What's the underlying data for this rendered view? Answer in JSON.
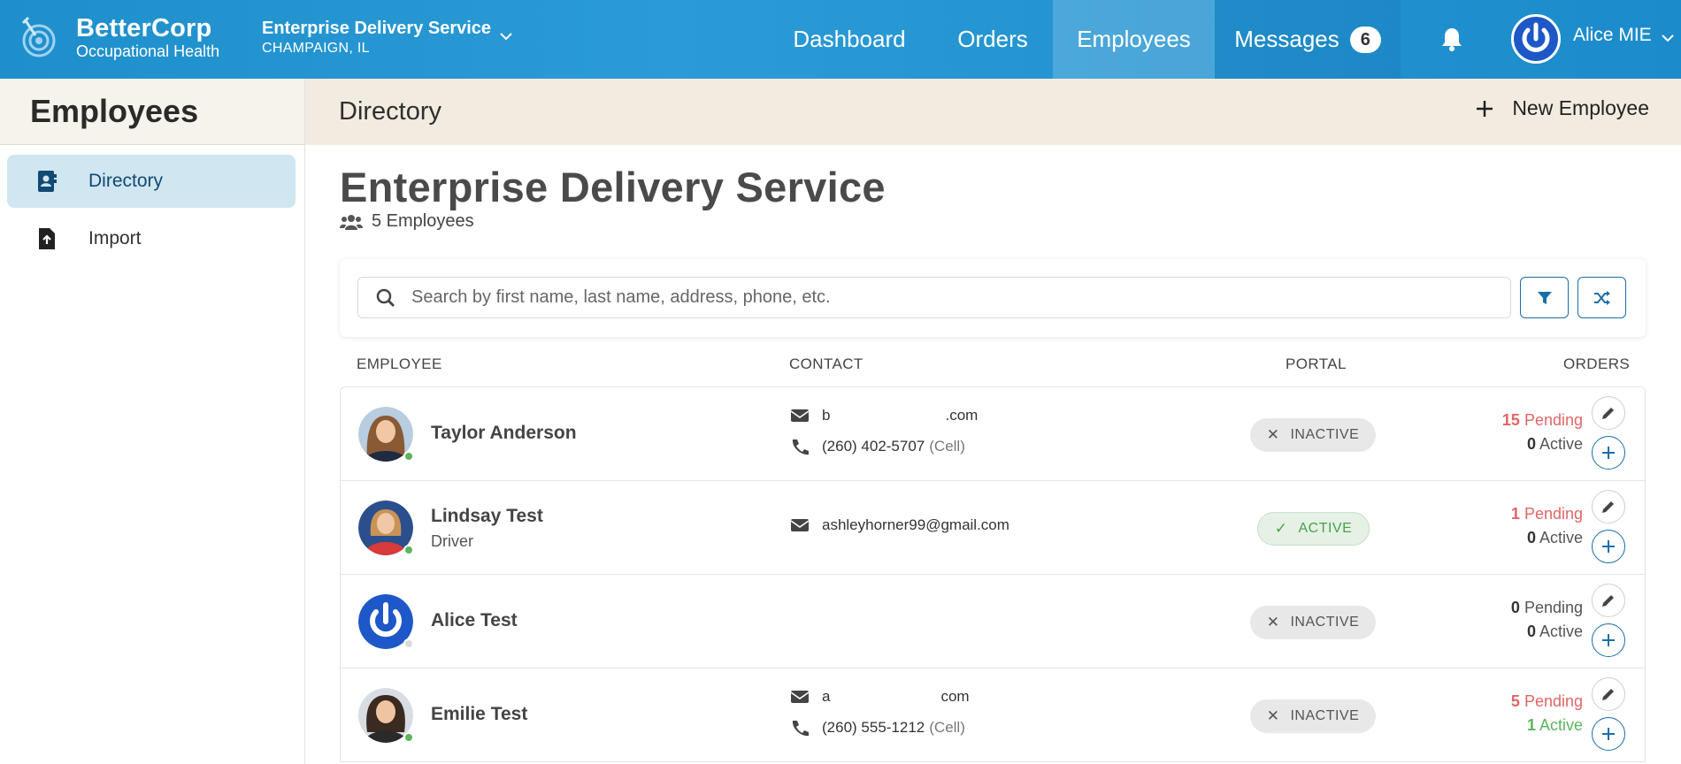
{
  "colors": {
    "brand": "#2a9bd6",
    "active_nav_bg": "#46b0e0",
    "sidebar_active": "#d0e6f0",
    "pending": "#e06666",
    "active": "#5bb55b",
    "accent_button": "#1a6ea8"
  },
  "topbar": {
    "brand_name": "BetterCorp",
    "brand_sub": "Occupational Health",
    "org_name": "Enterprise Delivery Service",
    "org_location": "CHAMPAIGN, IL",
    "nav": {
      "dashboard": "Dashboard",
      "orders": "Orders",
      "employees": "Employees",
      "messages": "Messages",
      "messages_count": "6"
    },
    "user_name": "Alice MIE"
  },
  "sidebar": {
    "title": "Employees",
    "items": [
      {
        "label": "Directory",
        "icon": "address-book-icon",
        "active": true
      },
      {
        "label": "Import",
        "icon": "file-upload-icon",
        "active": false
      }
    ]
  },
  "main": {
    "header_title": "Directory",
    "new_employee_label": "New Employee",
    "company_title": "Enterprise Delivery Service",
    "employee_count": "5 Employees",
    "search_placeholder": "Search by first name, last name, address, phone, etc.",
    "columns": {
      "employee": "EMPLOYEE",
      "contact": "CONTACT",
      "portal": "PORTAL",
      "orders": "ORDERS"
    },
    "rows": [
      {
        "name": "Taylor Anderson",
        "role": "",
        "email_start": "b",
        "email_end": ".com",
        "phone": "(260) 402-5707",
        "phone_label": "(Cell)",
        "portal": "INACTIVE",
        "pending": "15",
        "pending_label": "Pending",
        "active": "0",
        "active_label": "Active",
        "online": true
      },
      {
        "name": "Lindsay Test",
        "role": "Driver",
        "email": "ashleyhorner99@gmail.com",
        "portal": "ACTIVE",
        "pending": "1",
        "pending_label": "Pending",
        "active": "0",
        "active_label": "Active",
        "online": true
      },
      {
        "name": "Alice Test",
        "role": "",
        "portal": "INACTIVE",
        "pending": "0",
        "pending_label": "Pending",
        "active": "0",
        "active_label": "Active",
        "online": false
      },
      {
        "name": "Emilie Test",
        "role": "",
        "email_start": "a",
        "email_end": "com",
        "phone": "(260) 555-1212",
        "phone_label": "(Cell)",
        "portal": "INACTIVE",
        "pending": "5",
        "pending_label": "Pending",
        "active": "1",
        "active_label": "Active",
        "online": true
      }
    ]
  }
}
